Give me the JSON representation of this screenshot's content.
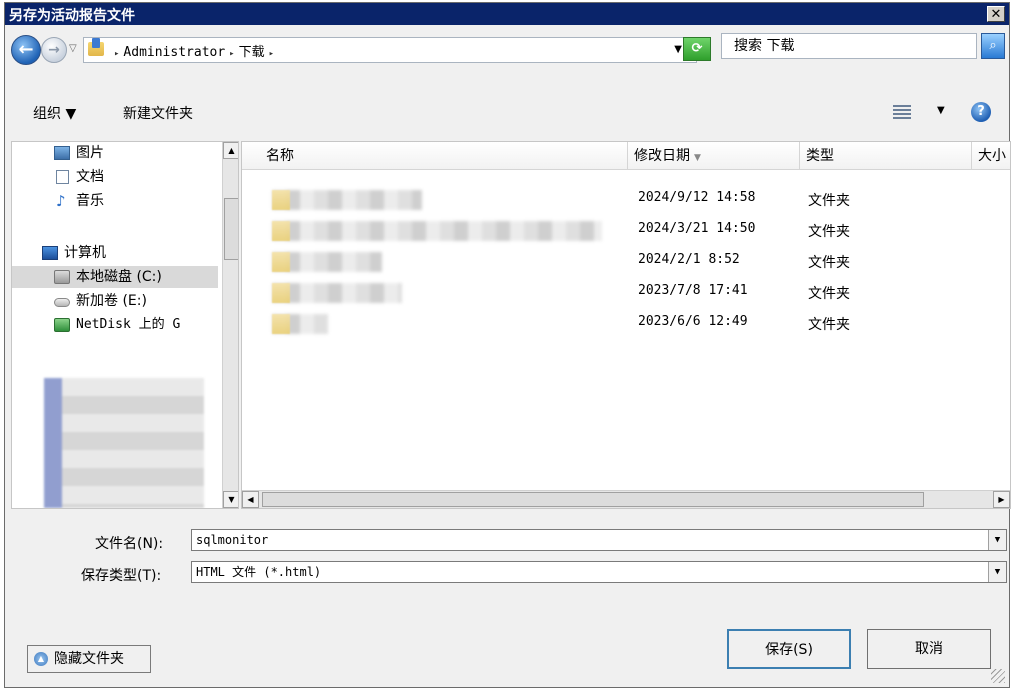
{
  "window": {
    "title": "另存为活动报告文件",
    "close_label": "✕"
  },
  "navbar": {
    "breadcrumb": [
      "Administrator",
      "下载"
    ],
    "search_placeholder": "搜索 下载"
  },
  "toolbar": {
    "organize_label": "组织 ▼",
    "new_folder_label": "新建文件夹"
  },
  "nav_pane": {
    "items": [
      {
        "label": "图片",
        "icon": "picture-icon"
      },
      {
        "label": "文档",
        "icon": "document-icon"
      },
      {
        "label": "音乐",
        "icon": "music-icon"
      },
      {
        "label": "计算机",
        "icon": "computer-icon"
      },
      {
        "label": "本地磁盘 (C:)",
        "icon": "local-disk-icon",
        "selected": true
      },
      {
        "label": "新加卷 (E:)",
        "icon": "volume-icon"
      },
      {
        "label": "NetDisk 上的 G",
        "icon": "network-drive-icon"
      }
    ]
  },
  "file_list": {
    "columns": [
      "名称",
      "修改日期",
      "类型",
      "大小"
    ],
    "sort_column": "修改日期",
    "rows": [
      {
        "date": "2024/9/12 14:58",
        "type": "文件夹"
      },
      {
        "date": "2024/3/21 14:50",
        "type": "文件夹"
      },
      {
        "date": "2024/2/1 8:52",
        "type": "文件夹"
      },
      {
        "date": "2023/7/8 17:41",
        "type": "文件夹"
      },
      {
        "date": "2023/6/6 12:49",
        "type": "文件夹"
      }
    ]
  },
  "form": {
    "filename_label": "文件名(N):",
    "filename_value": "sqlmonitor",
    "filetype_label": "保存类型(T):",
    "filetype_value": "HTML 文件 (*.html)"
  },
  "buttons": {
    "hide_folders": "隐藏文件夹",
    "save": "保存(S)",
    "cancel": "取消"
  },
  "colors": {
    "titlebar": "#0a246a",
    "selection": "#d9d9d9",
    "save_border": "#3c7fb1"
  }
}
